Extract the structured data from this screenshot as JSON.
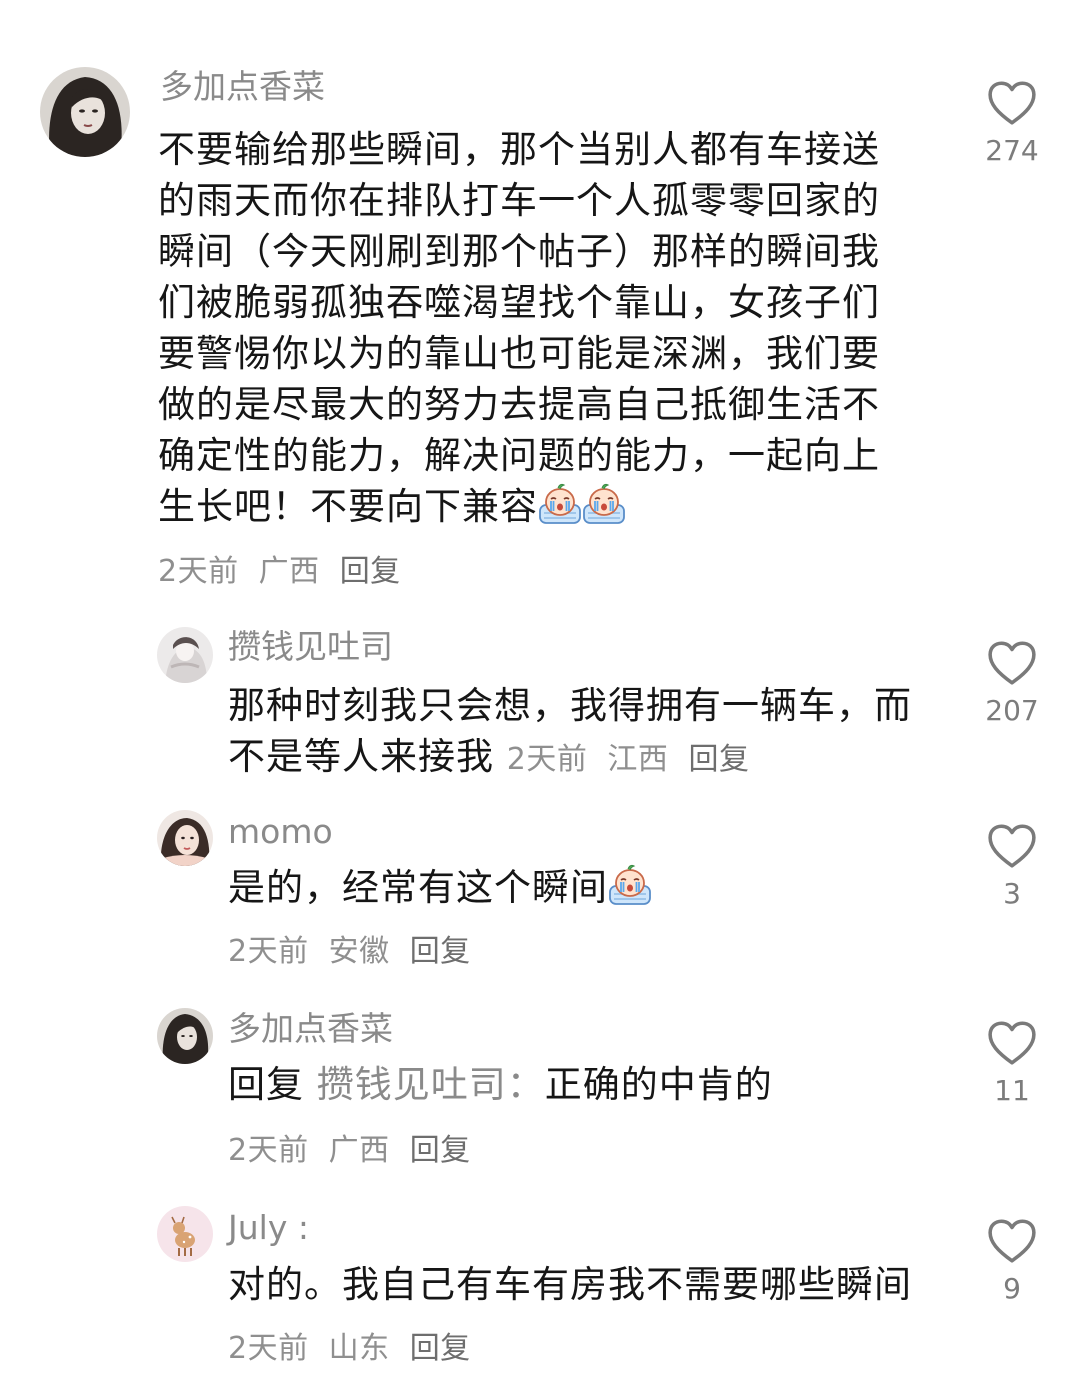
{
  "comments": [
    {
      "username": "多加点香菜",
      "text_lines": [
        "不要输给那些瞬间，那个当别人都有车接送",
        "的雨天而你在排队打车一个人孤零零回家的",
        "瞬间（今天刚刷到那个帖子）那样的瞬间我",
        "们被脆弱孤独吞噬渴望找个靠山，女孩子们",
        "要警惕你以为的靠山也可能是深渊，我们要",
        "做的是尽最大的努力去提高自己抵御生活不",
        "确定性的能力，解决问题的能力，一起向上",
        "生长吧！不要向下兼容"
      ],
      "time": "2天前",
      "location": "广西",
      "reply_label": "回复",
      "likes": "274"
    },
    {
      "username": "攒钱见吐司",
      "text_line1": "那种时刻我只会想，我得拥有一辆车，而",
      "text_line2": "不是等人来接我",
      "time": "2天前",
      "location": "江西",
      "reply_label": "回复",
      "likes": "207"
    },
    {
      "username": "momo",
      "text": "是的，经常有这个瞬间",
      "time": "2天前",
      "location": "安徽",
      "reply_label": "回复",
      "likes": "3"
    },
    {
      "username": "多加点香菜",
      "reply_prefix": "回复",
      "reply_target": "攒钱见吐司：",
      "text": "正确的中肯的",
      "time": "2天前",
      "location": "广西",
      "reply_label": "回复",
      "likes": "11"
    },
    {
      "username": "July :",
      "text": "对的。我自己有车有房我不需要哪些瞬间",
      "time": "2天前",
      "location": "山东",
      "reply_label": "回复",
      "likes": "9"
    }
  ],
  "icons": {
    "like": "heart-outline-icon",
    "emoji": "crying-face-emoji"
  },
  "colors": {
    "username": "#8a8a8a",
    "text": "#161616",
    "meta": "#8f8f8f"
  }
}
